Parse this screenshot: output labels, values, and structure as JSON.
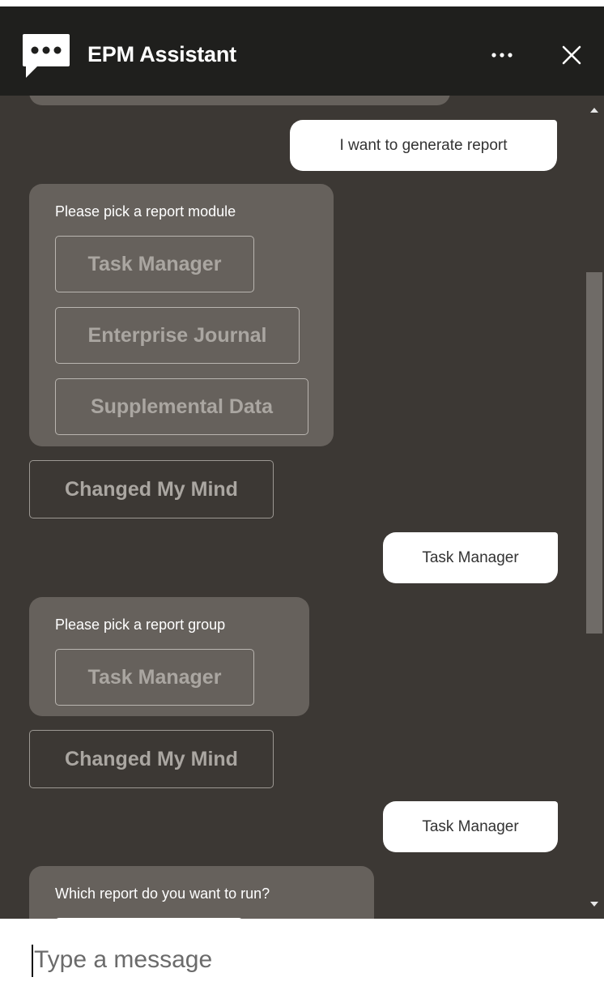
{
  "header": {
    "title": "EPM Assistant",
    "logo_icon": "chat-bubble-icon",
    "more_icon": "more-horizontal-icon",
    "close_icon": "close-icon"
  },
  "messages": [
    {
      "type": "user",
      "text": "I want to generate report"
    },
    {
      "type": "bot",
      "prompt": "Please pick a report module",
      "choices": [
        "Task Manager",
        "Enterprise Journal",
        "Supplemental Data"
      ]
    },
    {
      "type": "action",
      "label": "Changed My Mind"
    },
    {
      "type": "user",
      "text": "Task Manager"
    },
    {
      "type": "bot",
      "prompt": "Please pick a report group",
      "choices": [
        "Task Manager"
      ]
    },
    {
      "type": "action",
      "label": "Changed My Mind"
    },
    {
      "type": "user",
      "text": "Task Manager"
    },
    {
      "type": "bot",
      "prompt": "Which report do you want to run?",
      "choices": []
    }
  ],
  "input": {
    "placeholder": "Type a message"
  },
  "colors": {
    "header_bg": "#1f1f1d",
    "chat_bg": "#3c3834",
    "bot_bubble": "#66615c",
    "user_bubble": "#ffffff"
  }
}
